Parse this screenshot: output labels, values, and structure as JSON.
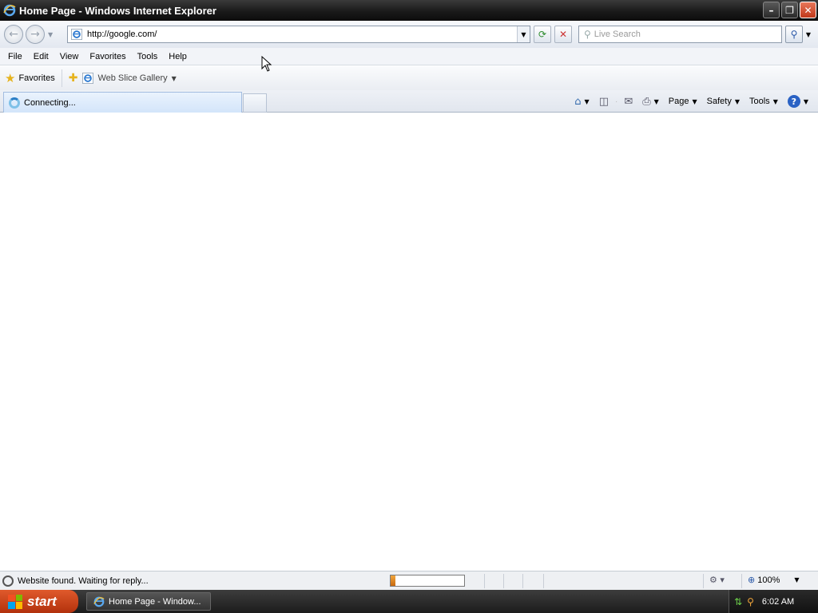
{
  "window": {
    "title": "Home Page - Windows Internet Explorer",
    "minimize": "–",
    "restore": "❐",
    "close": "✕"
  },
  "nav": {
    "back_icon": "←",
    "forward_icon": "→",
    "history_dropdown": "▼",
    "address_url": "http://google.com/",
    "address_dropdown": "▼",
    "refresh_icon": "⟳",
    "stop_icon": "✕",
    "search_placeholder": "Live Search",
    "search_go_icon": "⚲",
    "search_dropdown": "▼"
  },
  "menu": {
    "items": [
      {
        "label": "File"
      },
      {
        "label": "Edit"
      },
      {
        "label": "View"
      },
      {
        "label": "Favorites"
      },
      {
        "label": "Tools"
      },
      {
        "label": "Help"
      }
    ]
  },
  "favorites_bar": {
    "favorites_label": "Favorites",
    "web_slice_label": "Web Slice Gallery"
  },
  "tabs": {
    "active_label": "Connecting..."
  },
  "command_bar": {
    "page_label": "Page",
    "safety_label": "Safety",
    "tools_label": "Tools",
    "help_icon": "?"
  },
  "status": {
    "text": "Website found. Waiting for reply...",
    "progress": 0.07,
    "zoom": "100%"
  },
  "taskbar": {
    "start_label": "start",
    "task_label": "Home Page - Window...",
    "clock": "6:02 AM"
  },
  "colors": {
    "titlebar": "#1a1a1a",
    "start_button": "#c9431a",
    "progress_fill": "#e08a25"
  }
}
